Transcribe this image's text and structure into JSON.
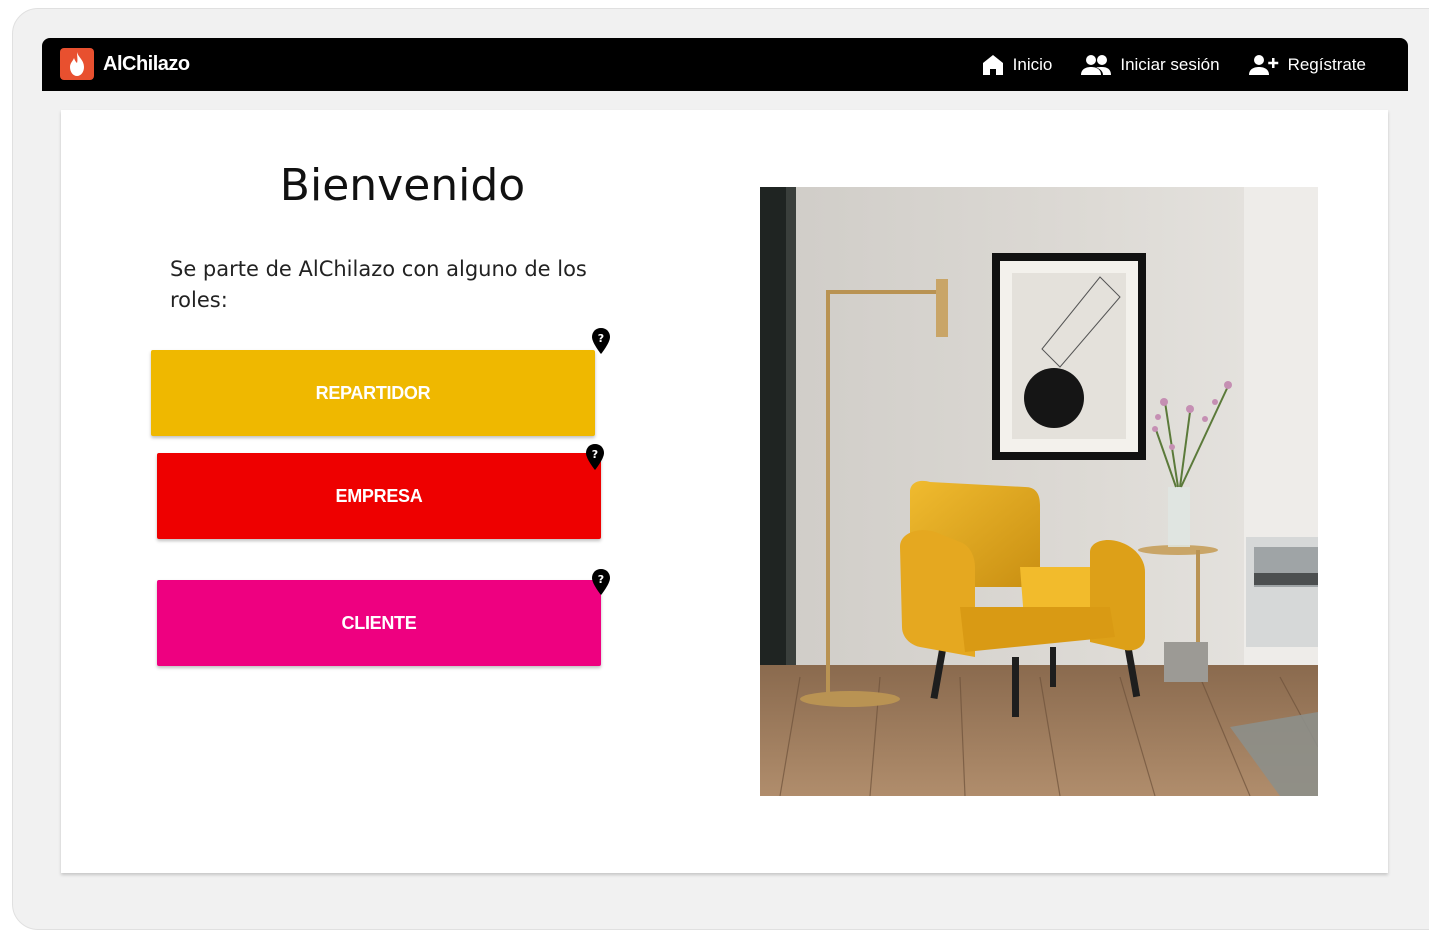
{
  "brand": {
    "name": "AlChilazo",
    "color": "#e8502f"
  },
  "nav": {
    "inicio": "Inicio",
    "iniciar_sesion": "Iniciar sesión",
    "registrate": "Regístrate"
  },
  "main": {
    "title": "Bienvenido",
    "subtitle": "Se parte de AlChilazo con alguno de los roles:"
  },
  "roles": [
    {
      "label": "REPARTIDOR",
      "color": "#efb800"
    },
    {
      "label": "EMPRESA",
      "color": "#ee0000"
    },
    {
      "label": "CLIENTE",
      "color": "#ee0080"
    }
  ],
  "icons": {
    "brand": "fire-icon",
    "inicio": "home-icon",
    "iniciar_sesion": "people-icon",
    "registrate": "person-add-icon",
    "help": "help-pin-icon"
  },
  "image": {
    "subject": "living-room-photo"
  }
}
